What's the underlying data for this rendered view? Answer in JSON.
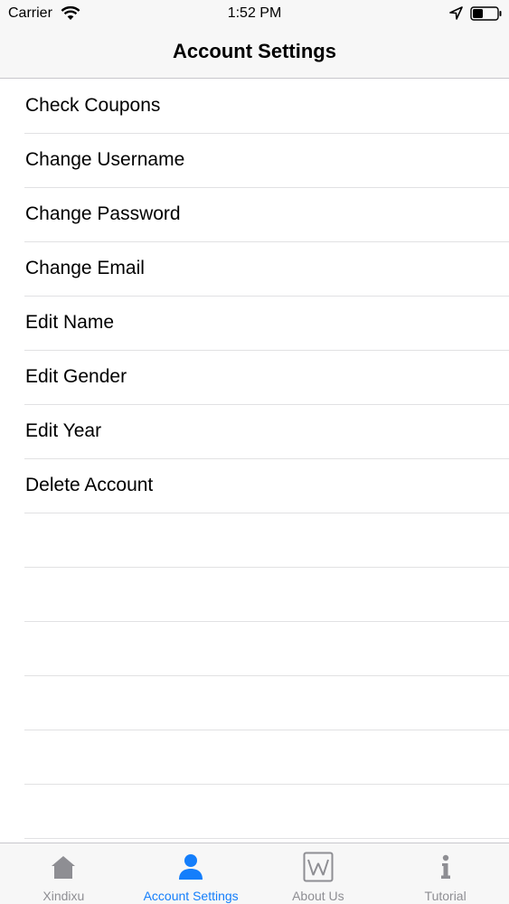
{
  "status_bar": {
    "carrier": "Carrier",
    "time": "1:52 PM"
  },
  "nav": {
    "title": "Account Settings"
  },
  "menu": {
    "items": [
      {
        "label": "Check Coupons"
      },
      {
        "label": "Change Username"
      },
      {
        "label": "Change Password"
      },
      {
        "label": "Change Email"
      },
      {
        "label": "Edit Name"
      },
      {
        "label": "Edit Gender"
      },
      {
        "label": "Edit Year"
      },
      {
        "label": "Delete Account"
      }
    ]
  },
  "tab_bar": {
    "tabs": [
      {
        "label": "Xindixu",
        "icon": "home-icon",
        "active": false
      },
      {
        "label": "Account Settings",
        "icon": "person-icon",
        "active": true
      },
      {
        "label": "About Us",
        "icon": "wikipedia-icon",
        "active": false
      },
      {
        "label": "Tutorial",
        "icon": "info-icon",
        "active": false
      }
    ]
  },
  "colors": {
    "accent": "#147efb",
    "inactive": "#8e8e93",
    "bar_background": "#f7f7f7",
    "separator": "#e1e1e3"
  }
}
